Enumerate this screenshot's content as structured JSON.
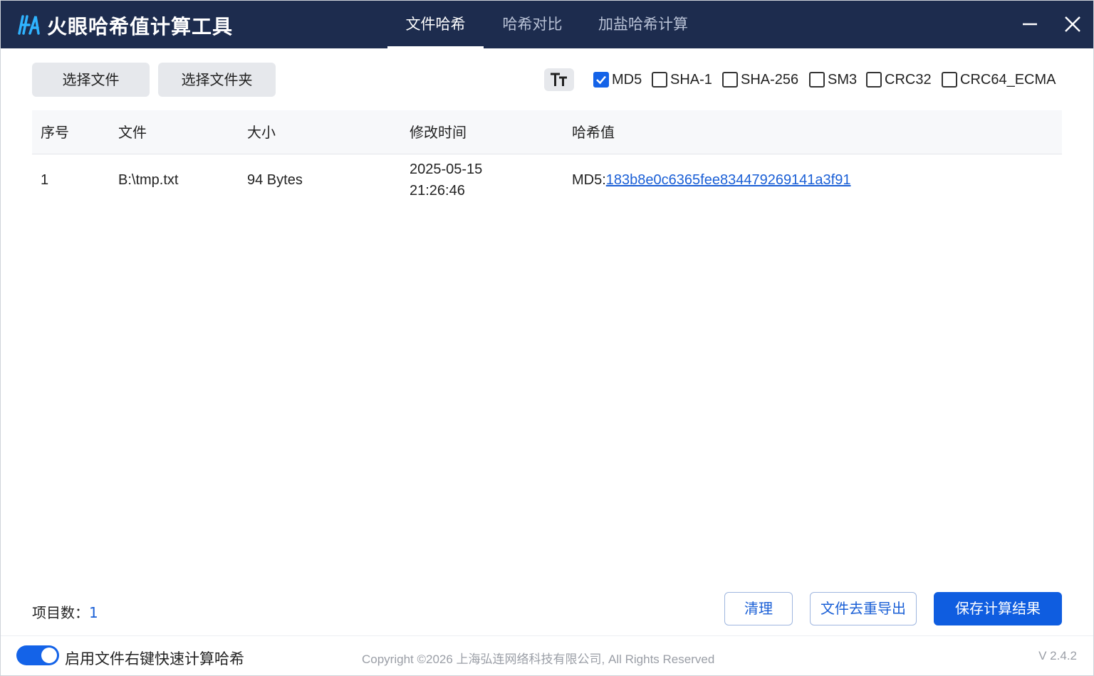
{
  "app": {
    "title": "火眼哈希值计算工具",
    "logo_text": "HA"
  },
  "tabs": [
    {
      "label": "文件哈希",
      "active": true
    },
    {
      "label": "哈希对比",
      "active": false
    },
    {
      "label": "加盐哈希计算",
      "active": false
    }
  ],
  "toolbar": {
    "select_file_label": "选择文件",
    "select_folder_label": "选择文件夹",
    "font_toggle_icon": "text-size-icon",
    "algorithms": [
      {
        "label": "MD5",
        "checked": true
      },
      {
        "label": "SHA-1",
        "checked": false
      },
      {
        "label": "SHA-256",
        "checked": false
      },
      {
        "label": "SM3",
        "checked": false
      },
      {
        "label": "CRC32",
        "checked": false
      },
      {
        "label": "CRC64_ECMA",
        "checked": false
      }
    ]
  },
  "table": {
    "headers": [
      "序号",
      "文件",
      "大小",
      "修改时间",
      "哈希值"
    ],
    "rows": [
      {
        "index": "1",
        "file": "B:\\tmp.txt",
        "size": "94 Bytes",
        "modified_date": "2025-05-15",
        "modified_time": "21:26:46",
        "hash_prefix": "MD5:",
        "hash_value": "183b8e0c6365fee834479269141a3f91"
      }
    ]
  },
  "footer": {
    "count_label": "项目数：",
    "count_value": "1",
    "clear_label": "清理",
    "dedupe_export_label": "文件去重导出",
    "save_label": "保存计算结果"
  },
  "statusbar": {
    "context_menu_toggle_label": "启用文件右键快速计算哈希",
    "context_menu_enabled": true,
    "copyright": "Copyright ©2026 上海弘连网络科技有限公司, All Rights Reserved",
    "version": "V 2.4.2"
  },
  "colors": {
    "titlebar": "#1d2c4e",
    "accent": "#0f5de0",
    "link": "#1a5fd6"
  }
}
